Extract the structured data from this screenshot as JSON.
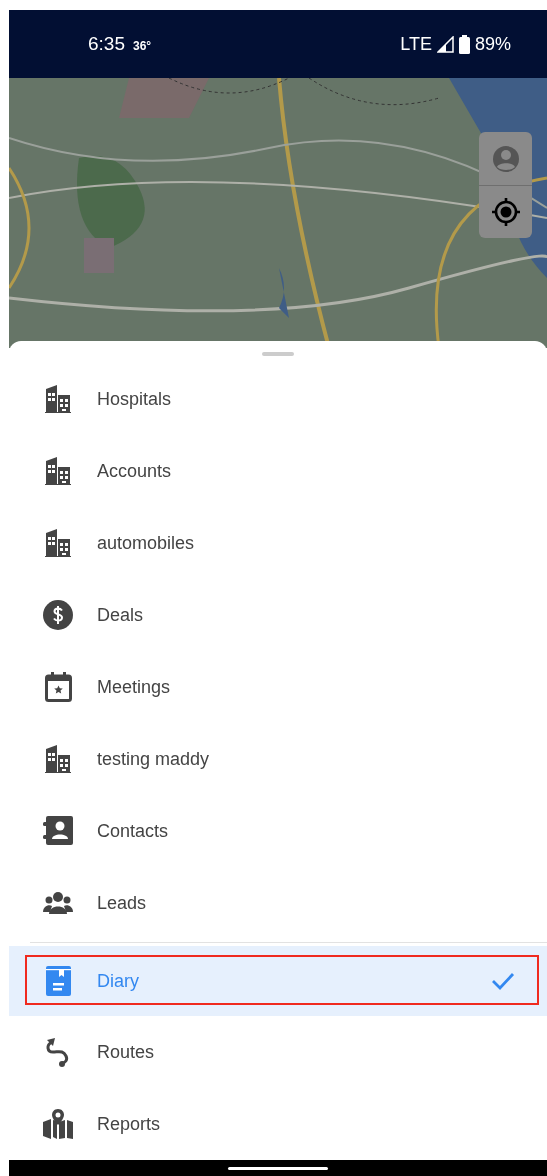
{
  "status_bar": {
    "time": "6:35",
    "temperature": "36°",
    "network": "LTE",
    "battery": "89%"
  },
  "map": {
    "kind": "picture",
    "controls": [
      {
        "kind": "account"
      },
      {
        "kind": "locate"
      }
    ]
  },
  "menu": {
    "items": [
      {
        "label": "Hospitals",
        "kind": "building",
        "selected": false,
        "highlighted": false
      },
      {
        "label": "Accounts",
        "kind": "building",
        "selected": false,
        "highlighted": false
      },
      {
        "label": "automobiles",
        "kind": "building",
        "selected": false,
        "highlighted": false
      },
      {
        "label": "Deals",
        "kind": "dollar",
        "selected": false,
        "highlighted": false
      },
      {
        "label": "Meetings",
        "kind": "calendar",
        "selected": false,
        "highlighted": false
      },
      {
        "label": "testing maddy",
        "kind": "building",
        "selected": false,
        "highlighted": false
      },
      {
        "label": "Contacts",
        "kind": "contacts",
        "selected": false,
        "highlighted": false
      },
      {
        "label": "Leads",
        "kind": "group",
        "selected": false,
        "highlighted": false
      },
      {
        "label": "Diary",
        "kind": "diary",
        "selected": true,
        "highlighted": true
      },
      {
        "label": "Routes",
        "kind": "route",
        "selected": false,
        "highlighted": false
      },
      {
        "label": "Reports",
        "kind": "map",
        "selected": false,
        "highlighted": false
      }
    ]
  }
}
